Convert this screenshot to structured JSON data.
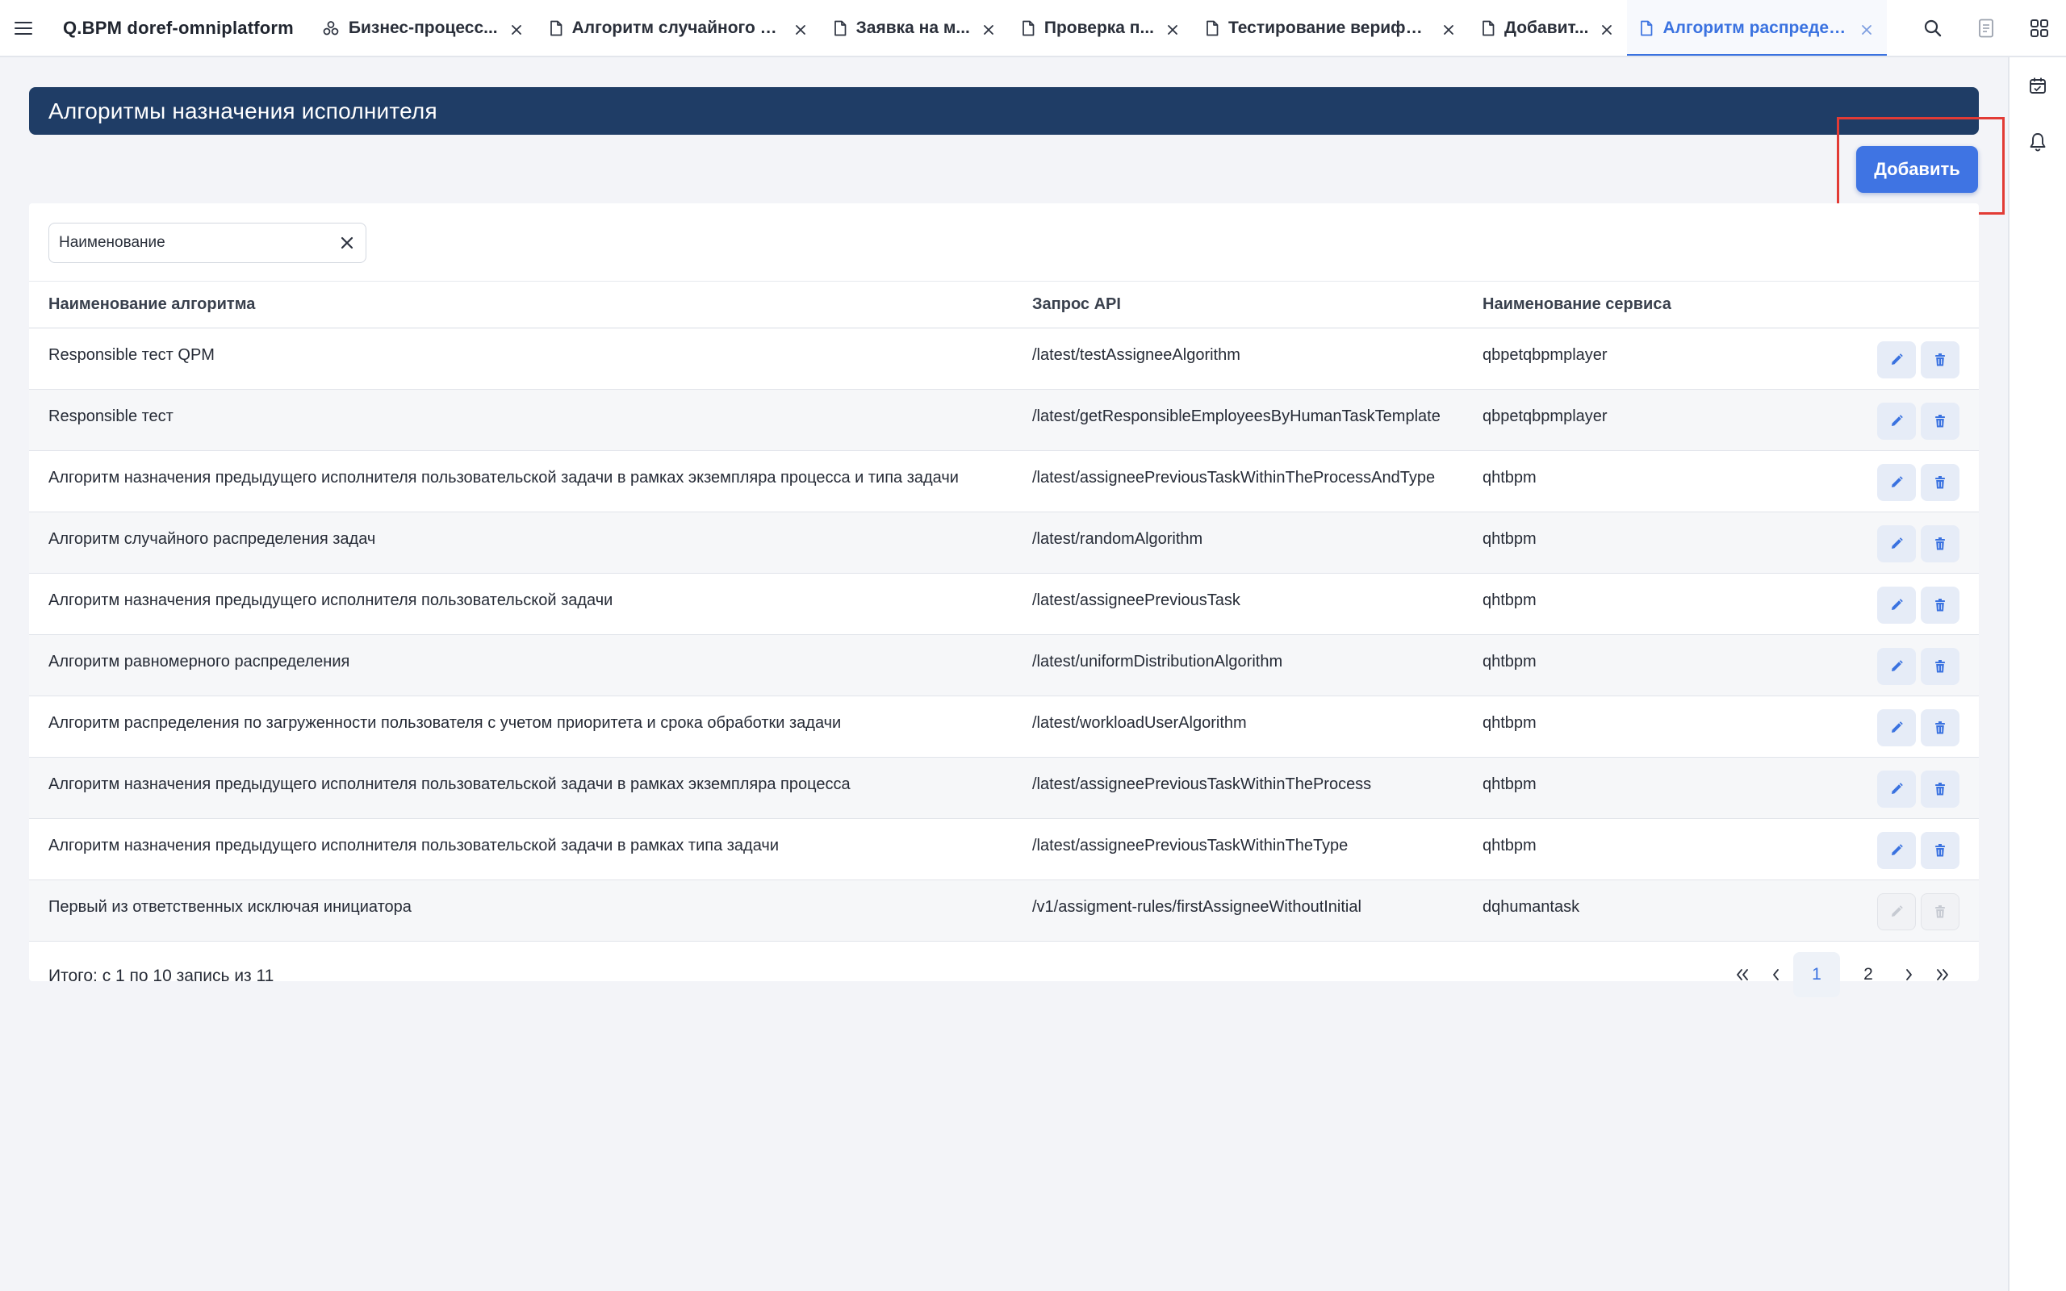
{
  "app": {
    "title": "Q.BPM doref-omniplatform"
  },
  "tabs": [
    {
      "label": "Бизнес-процесс...",
      "icon": "process-icon",
      "active": false
    },
    {
      "label": "Алгоритм случайного ра...",
      "icon": "document-icon",
      "active": false
    },
    {
      "label": "Заявка на м...",
      "icon": "document-icon",
      "active": false
    },
    {
      "label": "Проверка п...",
      "icon": "document-icon",
      "active": false
    },
    {
      "label": "Тестирование верифика...",
      "icon": "document-icon",
      "active": false
    },
    {
      "label": "Добавит...",
      "icon": "document-icon",
      "active": false
    },
    {
      "label": "Алгоритм распредел...",
      "icon": "document-icon",
      "active": true
    }
  ],
  "top_icons": [
    "search-icon",
    "notes-icon",
    "apps-grid-icon"
  ],
  "rail_icons": [
    "calendar-icon",
    "bell-icon"
  ],
  "page": {
    "title": "Алгоритмы назначения исполнителя",
    "add_label": "Добавить"
  },
  "filter": {
    "placeholder": "Наименование",
    "value": ""
  },
  "table": {
    "columns": [
      "Наименование алгоритма",
      "Запрос API",
      "Наименование сервиса"
    ],
    "rows": [
      {
        "name": "Responsible тест QPM",
        "api": "/latest/testAssigneeAlgorithm",
        "service": "qbpetqbpmplayer",
        "disabled": false
      },
      {
        "name": "Responsible тест",
        "api": "/latest/getResponsibleEmployeesByHumanTaskTemplate",
        "service": "qbpetqbpmplayer",
        "disabled": false
      },
      {
        "name": "Алгоритм назначения предыдущего исполнителя пользовательской задачи в рамках экземпляра процесса и типа задачи",
        "api": "/latest/assigneePreviousTaskWithinTheProcessAndType",
        "service": "qhtbpm",
        "disabled": false
      },
      {
        "name": "Алгоритм случайного распределения задач",
        "api": "/latest/randomAlgorithm",
        "service": "qhtbpm",
        "disabled": false
      },
      {
        "name": "Алгоритм назначения предыдущего исполнителя пользовательской задачи",
        "api": "/latest/assigneePreviousTask",
        "service": "qhtbpm",
        "disabled": false
      },
      {
        "name": "Алгоритм равномерного распределения",
        "api": "/latest/uniformDistributionAlgorithm",
        "service": "qhtbpm",
        "disabled": false
      },
      {
        "name": "Алгоритм распределения по загруженности пользователя с учетом приоритета и срока обработки задачи",
        "api": "/latest/workloadUserAlgorithm",
        "service": "qhtbpm",
        "disabled": false
      },
      {
        "name": "Алгоритм назначения предыдущего исполнителя пользовательской задачи в рамках экземпляра процесса",
        "api": "/latest/assigneePreviousTaskWithinTheProcess",
        "service": "qhtbpm",
        "disabled": false
      },
      {
        "name": "Алгоритм назначения предыдущего исполнителя пользовательской задачи в рамках типа задачи",
        "api": "/latest/assigneePreviousTaskWithinTheType",
        "service": "qhtbpm",
        "disabled": false
      },
      {
        "name": "Первый из ответственных исключая инициатора",
        "api": "/v1/assigment-rules/firstAssigneeWithoutInitial",
        "service": "dqhumantask",
        "disabled": true
      }
    ]
  },
  "footer": {
    "total": "Итого: с 1 по 10 запись из 11",
    "pages": [
      "1",
      "2"
    ],
    "current_page": "1"
  },
  "colors": {
    "accent": "#3a72e0",
    "header_bg": "#1f3d66",
    "button": "#3f74e3",
    "highlight": "#e23b35"
  }
}
